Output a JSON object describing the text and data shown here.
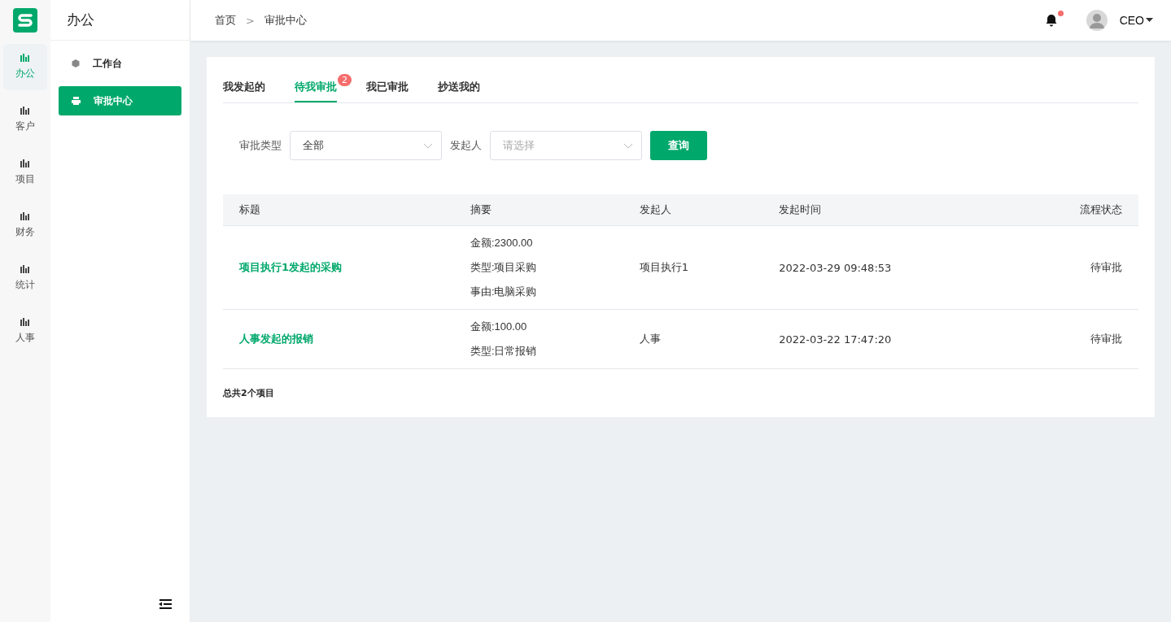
{
  "rail": [
    {
      "label": "办公",
      "selected": true
    },
    {
      "label": "客户",
      "selected": false
    },
    {
      "label": "项目",
      "selected": false
    },
    {
      "label": "财务",
      "selected": false
    },
    {
      "label": "统计",
      "selected": false
    },
    {
      "label": "人事",
      "selected": false
    }
  ],
  "sidebar": {
    "title": "办公",
    "items": [
      {
        "label": "工作台",
        "selected": false,
        "kind": "cube"
      },
      {
        "label": "审批中心",
        "selected": true,
        "kind": "printer"
      }
    ]
  },
  "breadcrumb": [
    "首页",
    "审批中心"
  ],
  "breadcrumb_separator": ">",
  "header": {
    "notification_unread": true,
    "user": "CEO"
  },
  "tabs": [
    {
      "label": "我发起的",
      "selected": false
    },
    {
      "label": "待我审批",
      "selected": true,
      "badge": "2"
    },
    {
      "label": "我已审批",
      "selected": false
    },
    {
      "label": "抄送我的",
      "selected": false
    }
  ],
  "filters": [
    {
      "label": "审批类型",
      "value": "全部"
    },
    {
      "label": "发起人",
      "placeholder": "请选择"
    }
  ],
  "query_button": "查询",
  "table": {
    "columns": [
      "标题",
      "摘要",
      "发起人",
      "发起时间",
      "流程状态"
    ],
    "rows": [
      {
        "title": "项目执行1发起的采购",
        "summary": [
          "金额:2300.00",
          "类型:项目采购",
          "事由:电脑采购"
        ],
        "initiator": "项目执行1",
        "time": "2022-03-29 09:48:53",
        "status": "待审批"
      },
      {
        "title": "人事发起的报销",
        "summary": [
          "金额:100.00",
          "类型:日常报销"
        ],
        "initiator": "人事",
        "time": "2022-03-22 17:47:20",
        "status": "待审批"
      }
    ]
  },
  "total": "总共2个项目"
}
